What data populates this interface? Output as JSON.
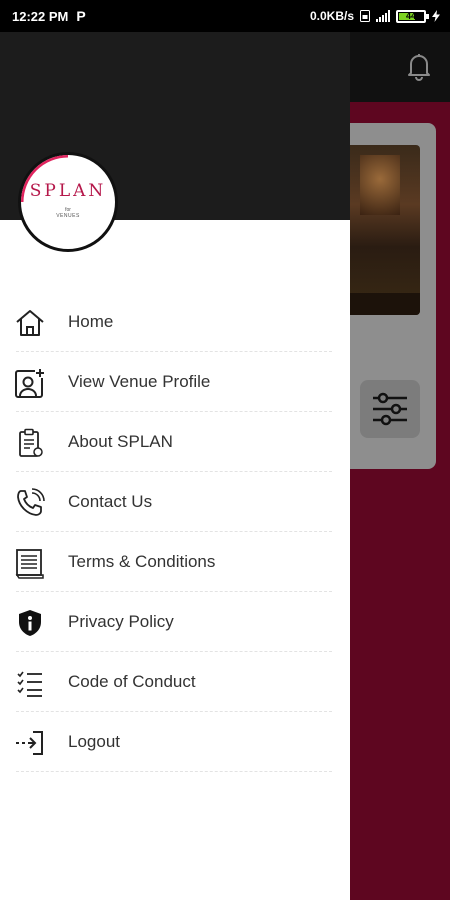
{
  "status_bar": {
    "time": "12:22 PM",
    "app_indicator": "P",
    "network_speed": "0.0KB/s",
    "battery_level": "44",
    "icons": [
      "sim-icon",
      "signal-icon",
      "battery-icon",
      "charging-icon"
    ]
  },
  "drawer": {
    "logo": {
      "name": "SPLAN",
      "for_text": "for",
      "subtitle": "VENUES"
    },
    "menu": [
      {
        "label": "Home",
        "icon": "home-icon"
      },
      {
        "label": "View Venue Profile",
        "icon": "user-add-icon"
      },
      {
        "label": "About SPLAN",
        "icon": "clipboard-icon"
      },
      {
        "label": "Contact Us",
        "icon": "phone-icon"
      },
      {
        "label": "Terms & Conditions",
        "icon": "document-icon"
      },
      {
        "label": "Privacy Policy",
        "icon": "shield-icon"
      },
      {
        "label": "Code of Conduct",
        "icon": "list-icon"
      },
      {
        "label": "Logout",
        "icon": "logout-icon"
      }
    ]
  },
  "background_app": {
    "icons": [
      "bell-icon",
      "filter-sliders-icon"
    ]
  },
  "colors": {
    "brand": "#b5174a",
    "background": "#5e0620",
    "drawer_header": "#1c1c1c"
  }
}
